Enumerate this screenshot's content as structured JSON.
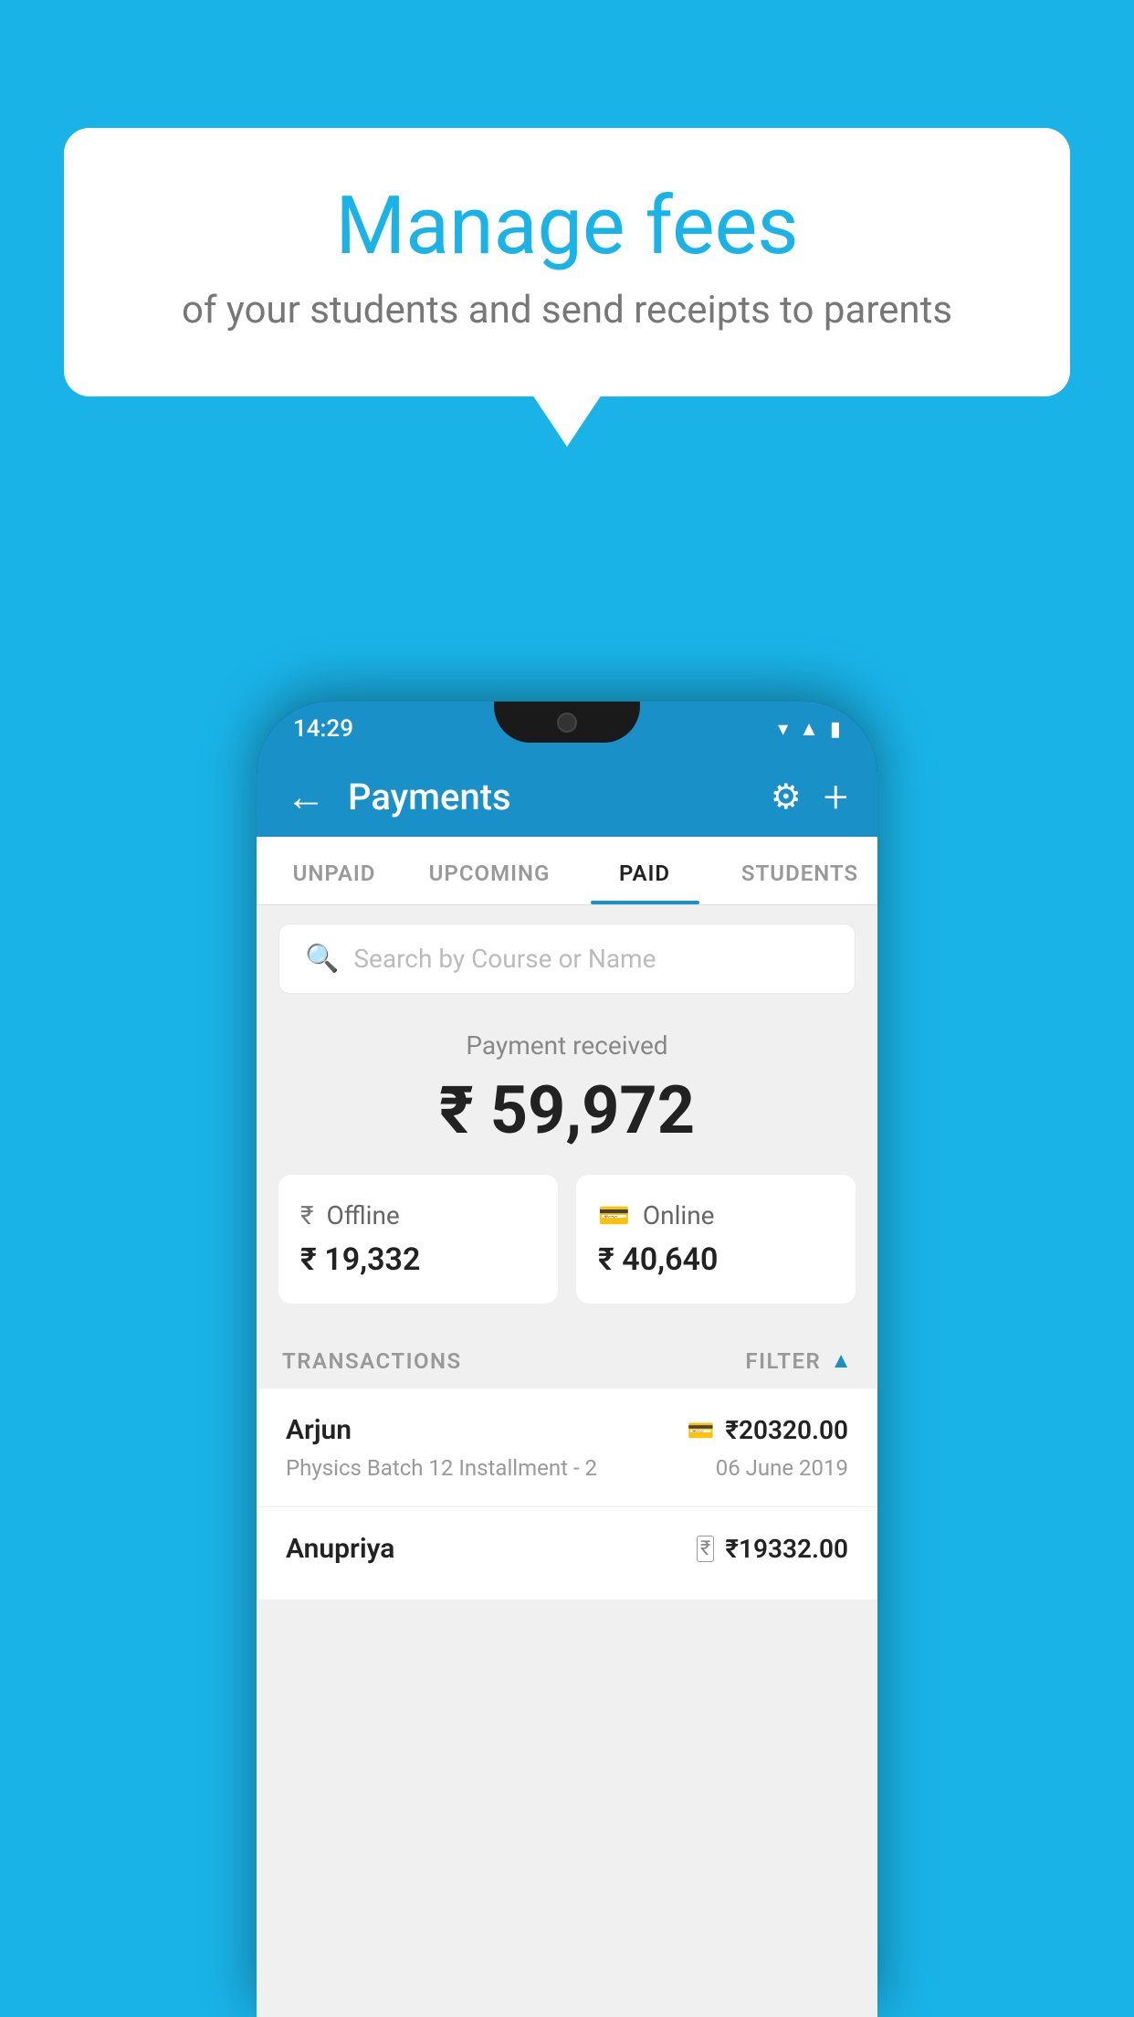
{
  "background_color": "#1ab3e8",
  "speech_bubble": {
    "title": "Manage fees",
    "subtitle": "of your students and send receipts to parents"
  },
  "status_bar": {
    "time": "14:29",
    "icons": "▼ ▲ ▮"
  },
  "toolbar": {
    "title": "Payments",
    "back_icon": "←",
    "gear_icon": "⚙",
    "plus_icon": "+"
  },
  "tabs": [
    {
      "label": "UNPAID",
      "active": false
    },
    {
      "label": "UPCOMING",
      "active": false
    },
    {
      "label": "PAID",
      "active": true
    },
    {
      "label": "STUDENTS",
      "active": false
    }
  ],
  "search": {
    "placeholder": "Search by Course or Name",
    "icon": "🔍"
  },
  "payment_summary": {
    "label": "Payment received",
    "amount": "₹ 59,972"
  },
  "payment_cards": [
    {
      "icon_label": "offline-payment-icon",
      "icon": "₹",
      "label": "Offline",
      "amount": "₹ 19,332"
    },
    {
      "icon_label": "online-payment-icon",
      "icon": "💳",
      "label": "Online",
      "amount": "₹ 40,640"
    }
  ],
  "transactions_section": {
    "header": "TRANSACTIONS",
    "filter_label": "FILTER",
    "filter_icon": "▼"
  },
  "transactions": [
    {
      "name": "Arjun",
      "course": "Physics Batch 12 Installment - 2",
      "amount": "₹20320.00",
      "date": "06 June 2019",
      "payment_type": "online",
      "icon": "💳"
    },
    {
      "name": "Anupriya",
      "course": "",
      "amount": "₹19332.00",
      "date": "",
      "payment_type": "offline",
      "icon": "₹"
    }
  ]
}
